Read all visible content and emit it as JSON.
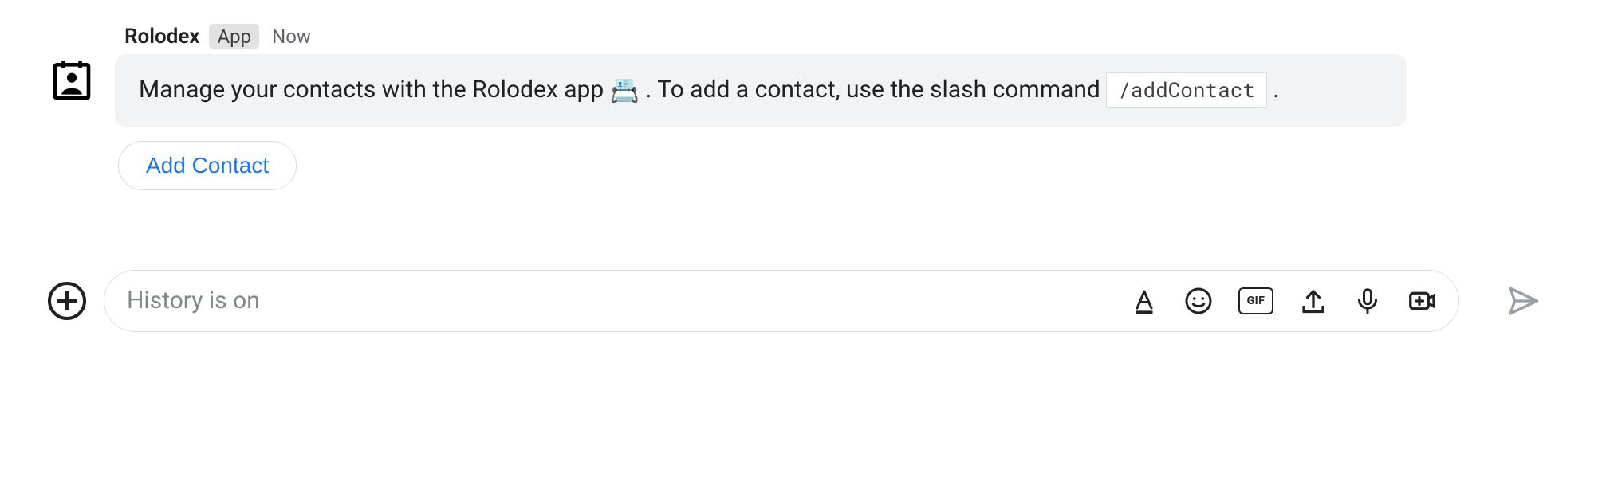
{
  "message": {
    "sender": "Rolodex",
    "badge": "App",
    "timestamp": "Now",
    "text_prefix": "Manage your contacts with the Rolodex app ",
    "text_after_emoji": ". To add a contact, use the slash command ",
    "command": "/addContact",
    "text_suffix": " .",
    "action_button": "Add Contact"
  },
  "compose": {
    "placeholder": "History is on",
    "gif_label": "GIF"
  }
}
